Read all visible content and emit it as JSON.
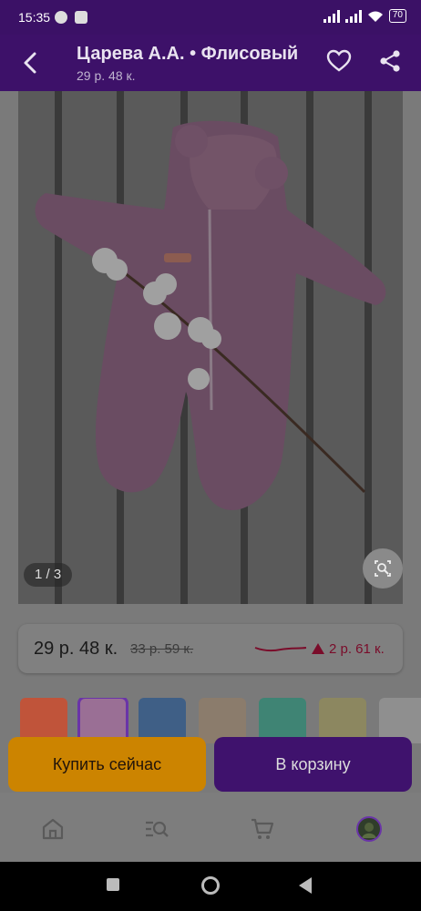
{
  "status_bar": {
    "time": "15:35",
    "battery": "70"
  },
  "app_bar": {
    "title": "Царева А.А. • Флисовый",
    "subtitle": "29 р. 48 к.",
    "back_icon": "chevron-left-icon",
    "favorite_icon": "heart-icon",
    "share_icon": "share-icon"
  },
  "gallery": {
    "counter": "1 / 3",
    "current": 1,
    "total": 3,
    "lens_icon": "visual-search-icon",
    "image": "pink-fleece-baby-jumpsuit"
  },
  "price_card": {
    "price": "29 р. 48 к.",
    "old_price": "33 р. 59 к.",
    "change": "2 р. 61 к.",
    "change_direction": "up",
    "trend_color": "#7a0c2a"
  },
  "thumbnails": {
    "selected_index": 1,
    "items": [
      {
        "name": "thumb-orange-suit",
        "color": "#c0543a"
      },
      {
        "name": "thumb-pink-suit",
        "color": "#9a6f95"
      },
      {
        "name": "thumb-blue-suit",
        "color": "#3f5f86"
      },
      {
        "name": "thumb-baby-photo",
        "color": "#8b7c6c"
      },
      {
        "name": "thumb-green-suit",
        "color": "#3f8474"
      },
      {
        "name": "thumb-yellow-suit",
        "color": "#8c8760"
      },
      {
        "name": "thumb-baby-white",
        "color": "#8f8f8f"
      }
    ]
  },
  "actions": {
    "buy_now": "Купить сейчас",
    "add_to_cart": "В корзину",
    "buy_color": "#cc8400",
    "cart_color": "#3f126d"
  },
  "bottom_nav": {
    "items": [
      {
        "name": "home-icon"
      },
      {
        "name": "catalog-search-icon"
      },
      {
        "name": "cart-icon"
      },
      {
        "name": "profile-avatar"
      }
    ]
  },
  "colors": {
    "brand": "#3d1169",
    "accent": "#6a34a8"
  }
}
